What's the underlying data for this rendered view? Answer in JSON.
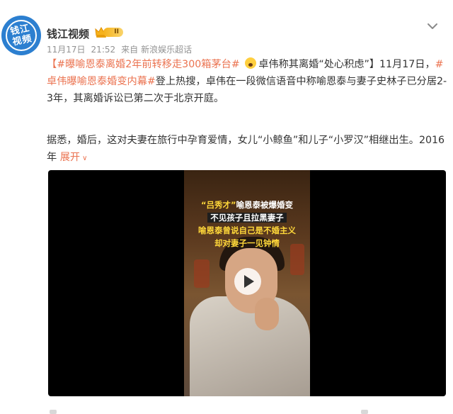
{
  "author": {
    "name": "钱江视频",
    "avatar_text": "钱江\n视频",
    "vip_badge": "II"
  },
  "meta": {
    "date": "11月17日",
    "time": "21:52",
    "source_prefix": "来自",
    "source": "新浪娱乐超话"
  },
  "post": {
    "bracket_open": "【",
    "topic1": "#曝喻恩泰离婚2年前转移走300箱茅台#",
    "topic2_prefix": "卓伟称其离婚“处心积虑”",
    "bracket_close": "】11月17日，",
    "topic3": "#卓伟曝喻恩泰婚变内幕#",
    "text1": "登上热搜，卓伟在一段微信语音中称喻恩泰与妻子史林子已分居2-3年，其离婚诉讼已第二次于北京开庭。",
    "text2": "据悉，婚后，这对夫妻在旅行中孕育爱情，女儿“小鲸鱼”和儿子“小罗汉”相继出生。2016年 ",
    "expand_label": "展开",
    "expand_icon": "chevron-down-icon"
  },
  "video": {
    "caption1_quote": "“吕秀才”",
    "caption1_rest": "喻恩泰被爆婚变",
    "caption2": "不见孩子且拉黑妻子",
    "caption3": "喻恩泰曾说自己是不婚主义",
    "caption4": "却对妻子一见钟情",
    "play_icon": "play-icon"
  },
  "colors": {
    "topic": "#eb7350",
    "meta": "#939393",
    "vip": "#f6b21b",
    "caption_yellow": "#ffd83a"
  }
}
